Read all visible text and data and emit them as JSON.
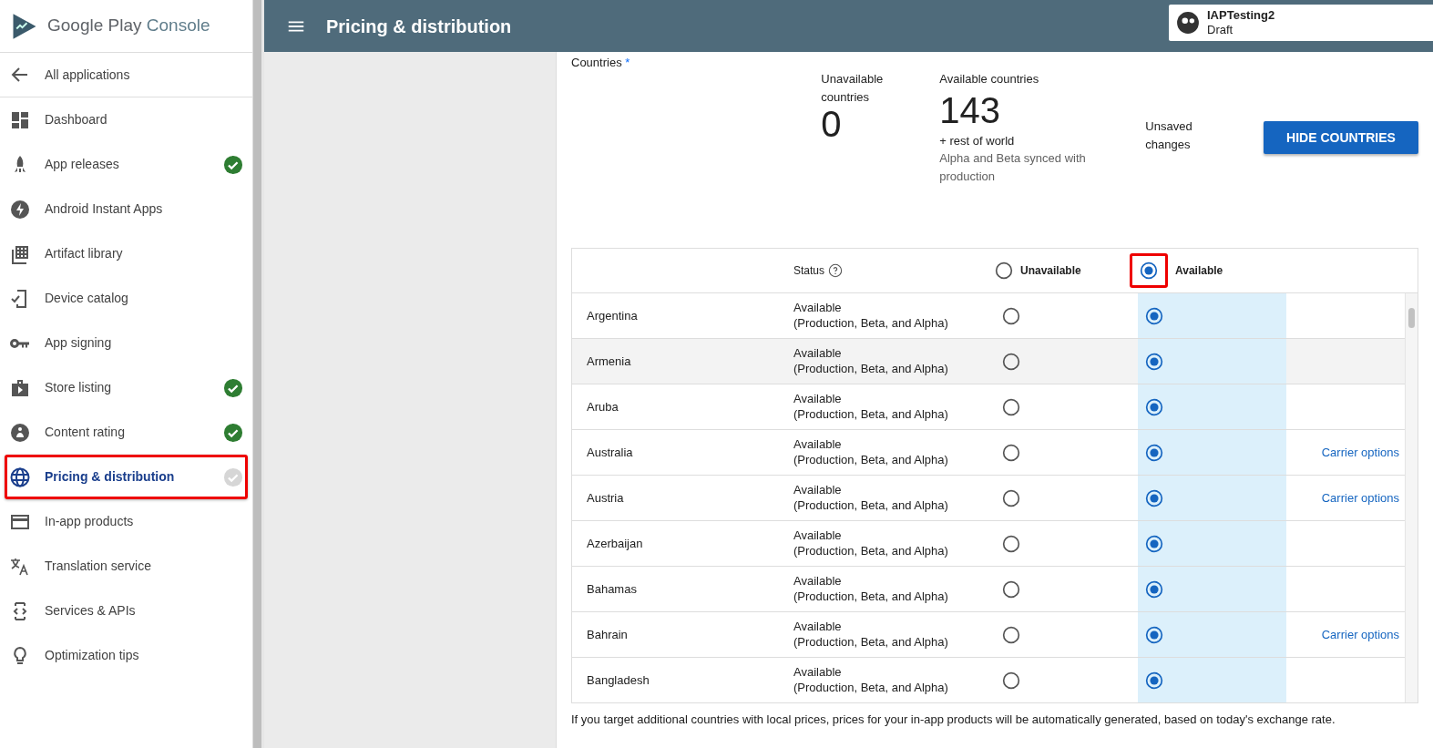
{
  "brand": {
    "name": "Google Play",
    "accent": "Console"
  },
  "sidebar": {
    "back_item": "All applications",
    "items": [
      {
        "label": "Dashboard",
        "kind": "plain",
        "selected": false
      },
      {
        "label": "App releases",
        "kind": "complete",
        "selected": false
      },
      {
        "label": "Android Instant Apps",
        "kind": "plain",
        "selected": false
      },
      {
        "label": "Artifact library",
        "kind": "plain",
        "selected": false
      },
      {
        "label": "Device catalog",
        "kind": "plain",
        "selected": false
      },
      {
        "label": "App signing",
        "kind": "plain",
        "selected": false
      },
      {
        "label": "Store listing",
        "kind": "complete",
        "selected": false
      },
      {
        "label": "Content rating",
        "kind": "complete",
        "selected": false
      },
      {
        "label": "Pricing & distribution",
        "kind": "incomplete",
        "selected": true
      },
      {
        "label": "In-app products",
        "kind": "plain",
        "selected": false
      },
      {
        "label": "Translation service",
        "kind": "plain",
        "selected": false
      },
      {
        "label": "Services & APIs",
        "kind": "plain",
        "selected": false
      },
      {
        "label": "Optimization tips",
        "kind": "plain",
        "selected": false
      }
    ]
  },
  "topbar": {
    "title": "Pricing & distribution",
    "app_name": "IAPTesting2",
    "app_status": "Draft"
  },
  "countries": {
    "label": "Countries",
    "required_mark": "*",
    "unavailable_label": "Unavailable countries",
    "unavailable_count": "0",
    "available_label": "Available countries",
    "available_count": "143",
    "rest_of_world": "+ rest of world",
    "sync_note": "Alpha and Beta synced with production",
    "unsaved": "Unsaved changes",
    "hide_button": "HIDE COUNTRIES"
  },
  "table": {
    "columns": [
      {
        "label": "Status",
        "kind": "help"
      },
      {
        "label": "Unavailable",
        "kind": "radio",
        "selected": false
      },
      {
        "label": "Available",
        "kind": "radio",
        "selected": true
      }
    ],
    "rows": [
      {
        "country": "Argentina",
        "status": "Available",
        "status_detail": "(Production, Beta, and Alpha)",
        "available": true
      },
      {
        "country": "Armenia",
        "status": "Available",
        "status_detail": "(Production, Beta, and Alpha)",
        "available": true,
        "hovered": true
      },
      {
        "country": "Aruba",
        "status": "Available",
        "status_detail": "(Production, Beta, and Alpha)",
        "available": true
      },
      {
        "country": "Australia",
        "status": "Available",
        "status_detail": "(Production, Beta, and Alpha)",
        "available": true,
        "link": "Carrier options"
      },
      {
        "country": "Austria",
        "status": "Available",
        "status_detail": "(Production, Beta, and Alpha)",
        "available": true,
        "link": "Carrier options"
      },
      {
        "country": "Azerbaijan",
        "status": "Available",
        "status_detail": "(Production, Beta, and Alpha)",
        "available": true
      },
      {
        "country": "Bahamas",
        "status": "Available",
        "status_detail": "(Production, Beta, and Alpha)",
        "available": true
      },
      {
        "country": "Bahrain",
        "status": "Available",
        "status_detail": "(Production, Beta, and Alpha)",
        "available": true,
        "link": "Carrier options"
      },
      {
        "country": "Bangladesh",
        "status": "Available",
        "status_detail": "(Production, Beta, and Alpha)",
        "available": true
      }
    ],
    "footer_note": "If you target additional countries with local prices, prices for your in-app products will be automatically generated, based on today's exchange rate."
  }
}
